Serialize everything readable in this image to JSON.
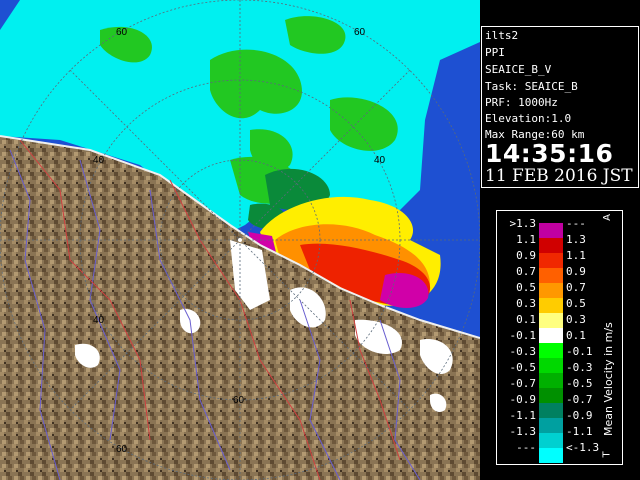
{
  "radar": {
    "range_labels": [
      "60",
      "60",
      "40",
      "40",
      "40",
      "60",
      "60"
    ]
  },
  "info": {
    "station": "ilts2",
    "scan_type": "PPI",
    "product": "SEAICE_B_V",
    "task": "Task: SEAICE_B",
    "prf": "PRF: 1000Hz",
    "elevation": "Elevation:1.0",
    "max_range": "Max Range:60 km",
    "time": "14:35:16",
    "date": "11 FEB 2016 JST"
  },
  "legend": {
    "title": "Mean Velocity in m/s",
    "top_marker": "A",
    "bottom_marker": "T",
    "colors": [
      "#c000a0",
      "#d00000",
      "#f02800",
      "#ff6000",
      "#ff9800",
      "#ffcc00",
      "#ffff80",
      "#ffffff",
      "#00ff00",
      "#00d800",
      "#00b000",
      "#009000",
      "#008060",
      "#00a0a0",
      "#00d0d0",
      "#00ffff"
    ],
    "rows": [
      {
        "left": ">1.3",
        "right": "---"
      },
      {
        "left": "1.1",
        "right": "1.3"
      },
      {
        "left": "0.9",
        "right": "1.1"
      },
      {
        "left": "0.7",
        "right": "0.9"
      },
      {
        "left": "0.5",
        "right": "0.7"
      },
      {
        "left": "0.3",
        "right": "0.5"
      },
      {
        "left": "0.1",
        "right": "0.3"
      },
      {
        "left": "-0.1",
        "right": "0.1"
      },
      {
        "left": "-0.3",
        "right": "-0.1"
      },
      {
        "left": "-0.5",
        "right": "-0.3"
      },
      {
        "left": "-0.7",
        "right": "-0.5"
      },
      {
        "left": "-0.9",
        "right": "-0.7"
      },
      {
        "left": "-1.1",
        "right": "-0.9"
      },
      {
        "left": "-1.3",
        "right": "-1.1"
      },
      {
        "left": "---",
        "right": "<-1.3"
      }
    ]
  }
}
